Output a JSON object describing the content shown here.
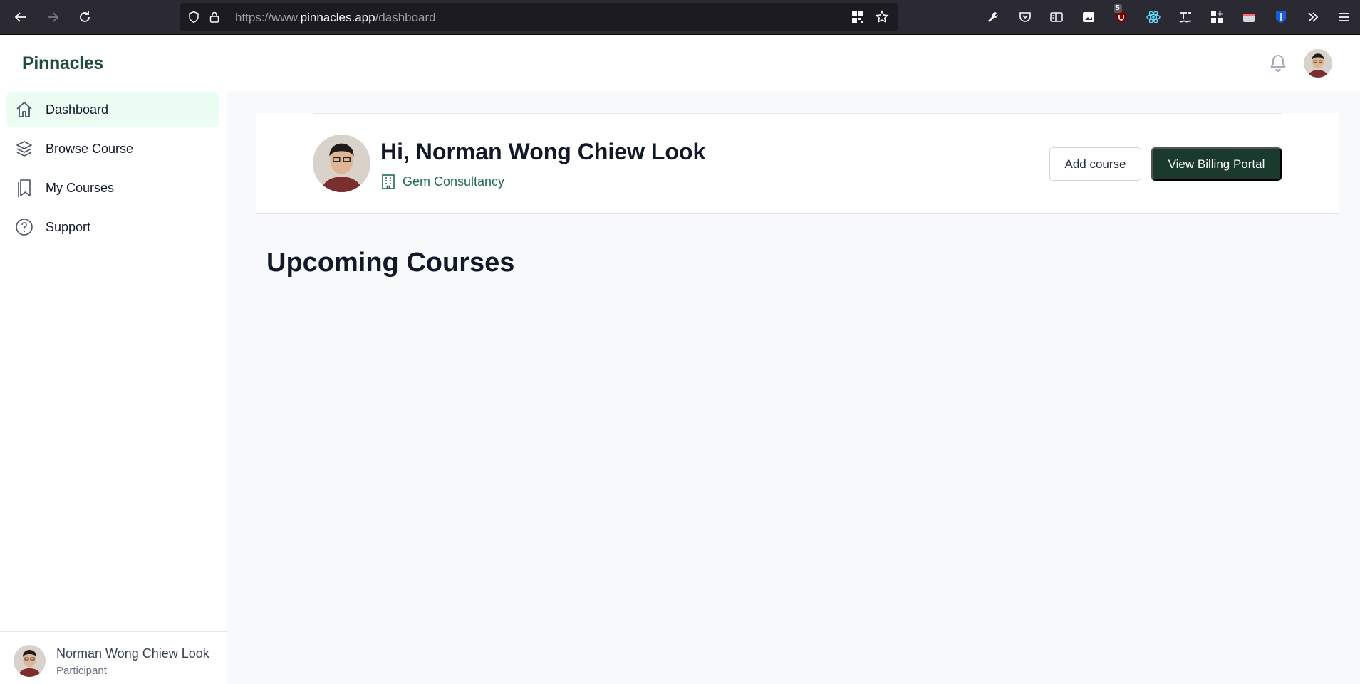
{
  "browser": {
    "url_prefix": "https://www.",
    "url_host": "pinnacles.app",
    "url_path": "/dashboard",
    "extension_badge": "5"
  },
  "sidebar": {
    "logo": "Pinnacles",
    "items": [
      {
        "label": "Dashboard",
        "icon": "home-icon",
        "active": true
      },
      {
        "label": "Browse Course",
        "icon": "layers-icon"
      },
      {
        "label": "My Courses",
        "icon": "bookmarks-icon"
      },
      {
        "label": "Support",
        "icon": "question-circle-icon"
      }
    ],
    "user": {
      "name": "Norman Wong Chiew Look",
      "role": "Participant"
    }
  },
  "profile": {
    "greeting": "Hi, Norman Wong Chiew Look",
    "company": "Gem Consultancy",
    "add_course_label": "Add course",
    "billing_label": "View Billing Portal"
  },
  "main": {
    "section_title": "Upcoming Courses"
  },
  "colors": {
    "brand": "#1f4d3a",
    "accent_button": "#1b3a2e",
    "active_nav_bg": "#ecfdf3"
  }
}
